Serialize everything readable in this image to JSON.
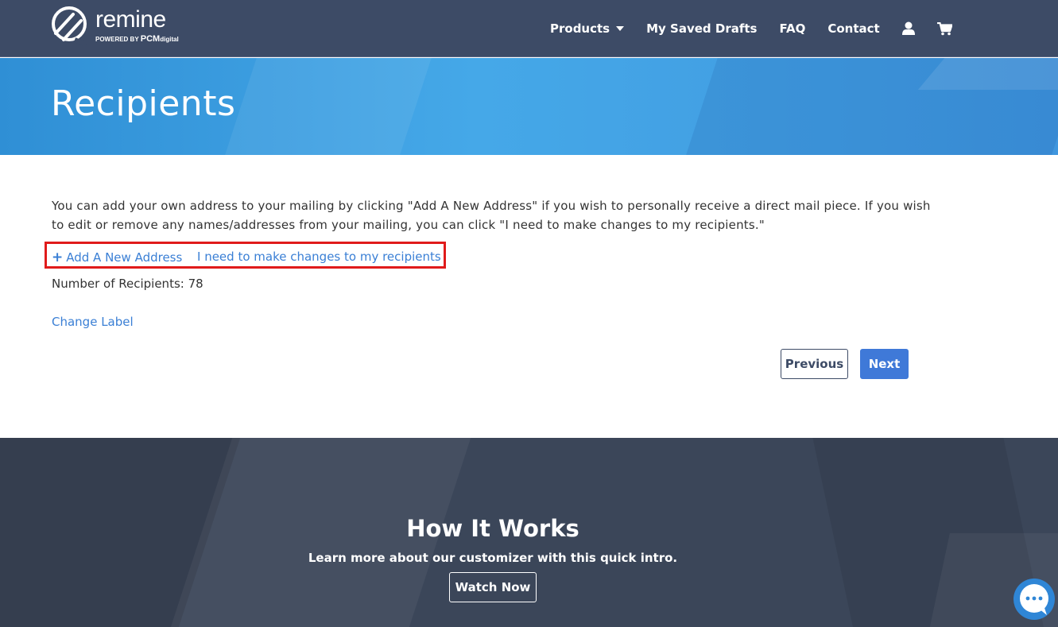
{
  "brand": {
    "name": "remine",
    "powered_prefix": "POWERED BY",
    "powered_brand": "PCM",
    "powered_suffix": "digital"
  },
  "nav": {
    "products": "Products",
    "saved_drafts": "My Saved Drafts",
    "faq": "FAQ",
    "contact": "Contact",
    "account_icon": "user-icon",
    "cart_icon": "cart-icon"
  },
  "hero": {
    "title": "Recipients"
  },
  "content": {
    "intro": "You can add your own address to your mailing by clicking \"Add A New Address\" if you wish to personally receive a direct mail piece. If you wish to edit or remove any names/addresses from your mailing, you can click \"I need to make changes to my recipients.\"",
    "add_address": "Add A New Address",
    "change_recipients": "I need to make changes to my recipients",
    "recipients_count": "Number of Recipients: 78",
    "change_label": "Change Label",
    "previous": "Previous",
    "next": "Next"
  },
  "footer": {
    "title": "How It Works",
    "subtitle": "Learn more about our customizer with this quick intro.",
    "watch": "Watch Now"
  },
  "colors": {
    "navbar": "#3d4b66",
    "hero": "#45a8e8",
    "link": "#3a7fd5",
    "highlight": "#e01b1b",
    "primary_button": "#3f79d8",
    "footer": "#3b4659",
    "chat": "#2f86d6"
  }
}
